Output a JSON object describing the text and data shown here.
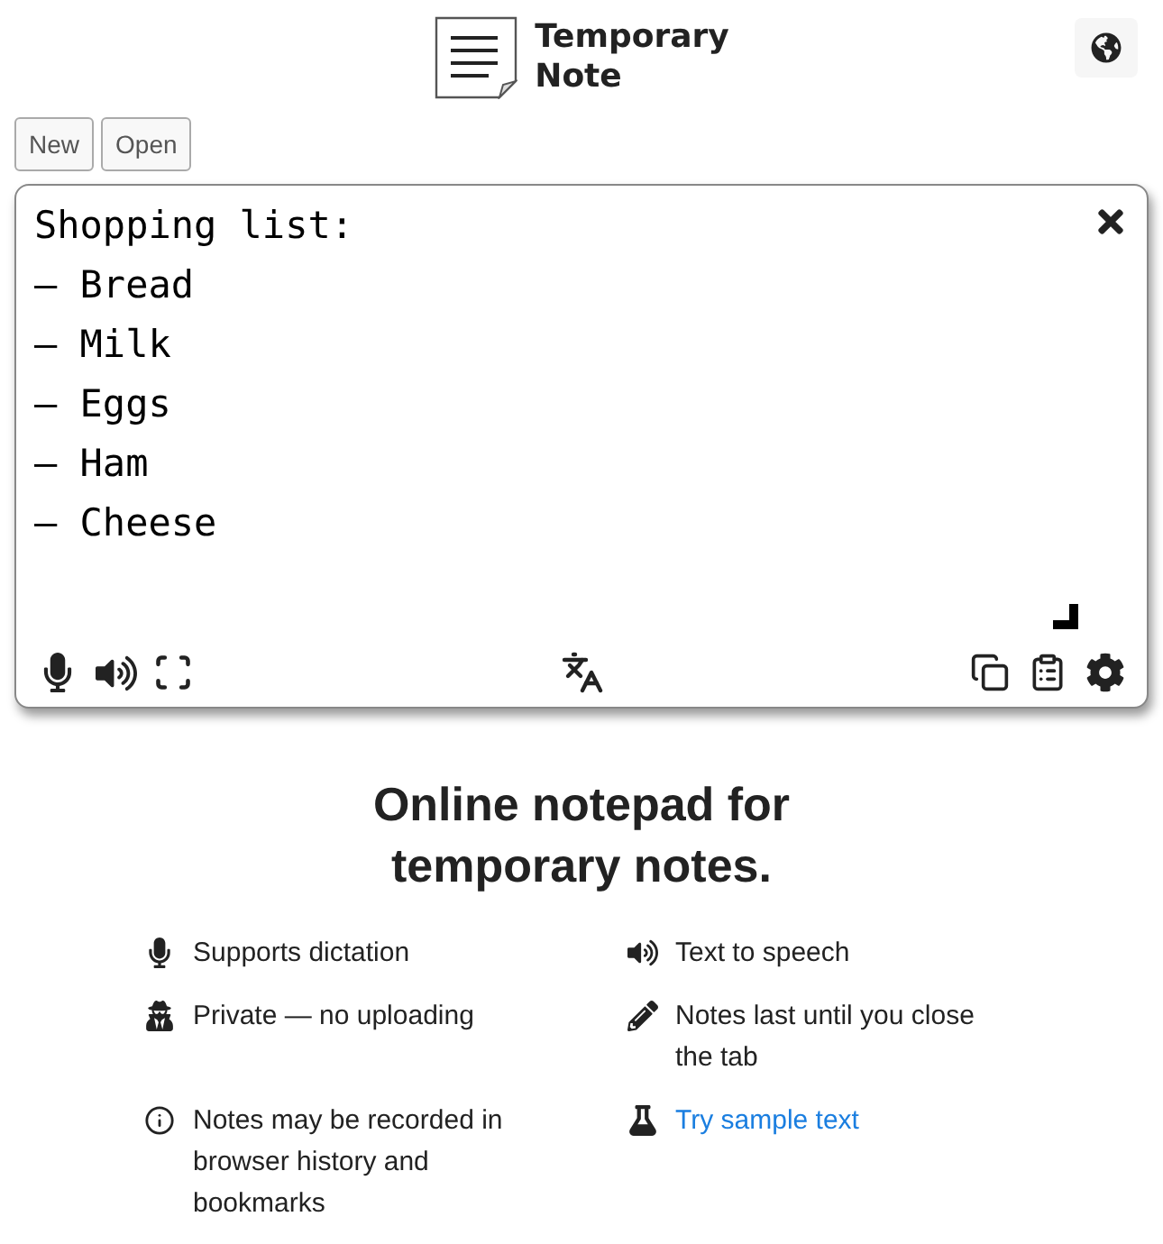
{
  "header": {
    "title_line_1": "Temporary",
    "title_line_2": "Note"
  },
  "toolbar": {
    "buttons": [
      "New",
      "Open"
    ]
  },
  "note": {
    "value": "Shopping list:\n– Bread\n– Milk\n– Eggs\n– Ham\n– Cheese"
  },
  "headline": "Online notepad for temporary notes.",
  "features": [
    {
      "kind": "text",
      "text": "Supports dictation"
    },
    {
      "kind": "text",
      "text": "Text to speech"
    },
    {
      "kind": "text",
      "text": "Private — no uploading"
    },
    {
      "kind": "text",
      "text": "Notes last until you close the tab"
    },
    {
      "kind": "text",
      "text": "Notes may be recorded in browser history and bookmarks"
    },
    {
      "kind": "link",
      "text": "Try sample text"
    }
  ]
}
